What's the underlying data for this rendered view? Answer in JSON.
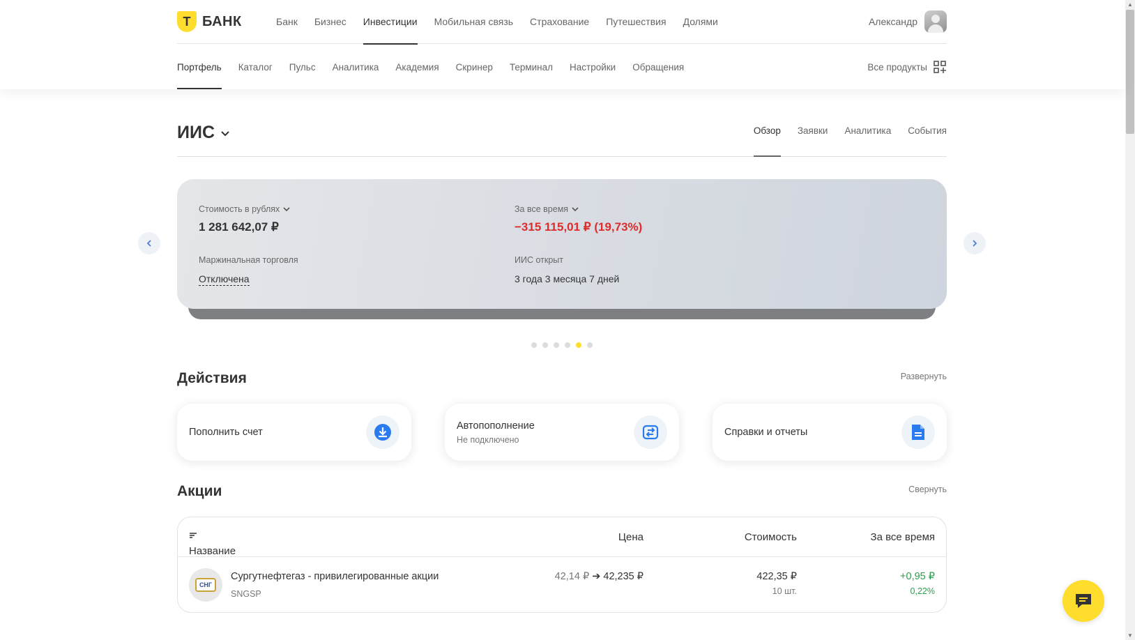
{
  "brand": {
    "logo_letter": "Т",
    "name": "БАНК",
    "accent": "#ffdd2d"
  },
  "top_nav": [
    "Банк",
    "Бизнес",
    "Инвестиции",
    "Мобильная связь",
    "Страхование",
    "Путешествия",
    "Долями"
  ],
  "top_nav_active": "Инвестиции",
  "user": {
    "name": "Александр"
  },
  "sub_nav": [
    "Портфель",
    "Каталог",
    "Пульс",
    "Аналитика",
    "Академия",
    "Скринер",
    "Терминал",
    "Настройки",
    "Обращения"
  ],
  "sub_nav_active": "Портфель",
  "all_products": "Все продукты",
  "account": {
    "title": "ИИС",
    "tabs": [
      "Обзор",
      "Заявки",
      "Аналитика",
      "События"
    ],
    "active_tab": "Обзор"
  },
  "summary": {
    "value_label": "Стоимость в рублях",
    "value": "1 281 642,07 ₽",
    "period_label": "За все время",
    "change": "−315 115,01 ₽ (19,73%)",
    "margin_label": "Маржинальная торговля",
    "margin_value": "Отключена",
    "opened_label": "ИИС открыт",
    "opened_value": "3 года 3 месяца 7 дней",
    "negative_color": "#dd2c2c",
    "slide_index": 5,
    "slide_count": 6
  },
  "actions": {
    "title": "Действия",
    "expand_label": "Развернуть",
    "items": [
      {
        "label": "Пополнить счет",
        "sub": "",
        "icon": "download-icon"
      },
      {
        "label": "Автопополнение",
        "sub": "Не подключено",
        "icon": "autorefill-icon"
      },
      {
        "label": "Справки и отчеты",
        "sub": "",
        "icon": "document-icon"
      }
    ]
  },
  "stocks": {
    "title": "Акции",
    "collapse_label": "Свернуть",
    "columns": {
      "name": "Название",
      "price": "Цена",
      "value": "Стоимость",
      "alltime": "За все время"
    },
    "rows": [
      {
        "name": "Сургутнефтегаз - привилегированные акции",
        "ticker": "SNGSP",
        "logo_text": "СНГ",
        "price_from": "42,14 ₽",
        "price_to": "42,235 ₽",
        "value": "422,35 ₽",
        "qty": "10 шт.",
        "gain": "+0,95 ₽",
        "gain_pct": "0,22%"
      }
    ]
  }
}
